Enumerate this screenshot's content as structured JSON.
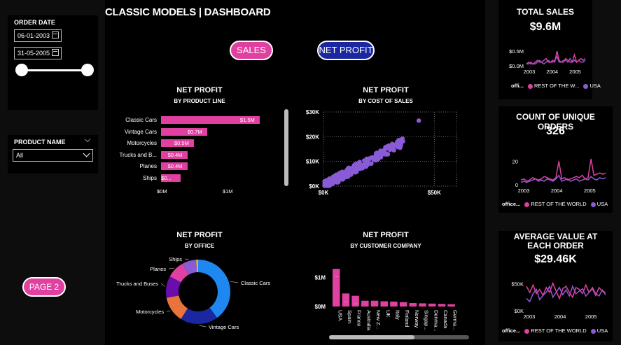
{
  "title": "CLASSIC MODELS | DASHBOARD",
  "filters": {
    "order_date_label": "ORDER DATE",
    "start_date": "06-01-2003",
    "end_date": "31-05-2005",
    "product_name_label": "PRODUCT NAME",
    "product_name_value": "All"
  },
  "toggle": {
    "sales": "SALES",
    "net_profit": "NET PROFIT"
  },
  "page2": "PAGE 2",
  "colors": {
    "pink": "#e040a0",
    "navy": "#1a27a0",
    "purple": "#8a5bd6",
    "blue": "#1e88f0"
  },
  "kpis": {
    "total_sales": {
      "title": "TOTAL SALES",
      "value": "$9.6M",
      "y_ticks": [
        "$0.5M",
        "$0.0M"
      ],
      "x_ticks": [
        "2003",
        "2004",
        "2005"
      ]
    },
    "unique_orders": {
      "title": "COUNT OF UNIQUE ORDERS",
      "value": "326",
      "y_ticks": [
        "20",
        "0"
      ],
      "x_ticks": [
        "2003",
        "2004",
        "2005"
      ]
    },
    "avg_order": {
      "title": "AVERAGE VALUE AT EACH ORDER",
      "value": "$29.46K",
      "y_ticks": [
        "$50K",
        "$0K"
      ],
      "x_ticks": [
        "2003",
        "2004",
        "2005"
      ]
    },
    "legend_short": {
      "prefix": "offi...",
      "rest": "REST OF THE W...",
      "usa": "USA"
    },
    "legend_long": {
      "prefix": "office...",
      "rest": "REST OF THE WORLD",
      "usa": "USA"
    }
  },
  "chart_data": [
    {
      "type": "bar",
      "title": "NET PROFIT",
      "subtitle": "BY PRODUCT LINE",
      "categories": [
        "Classic Cars",
        "Vintage Cars",
        "Motorcycles",
        "Trucks and B...",
        "Planes",
        "Ships"
      ],
      "values": [
        1.5,
        0.7,
        0.5,
        0.4,
        0.4,
        0.3
      ],
      "data_labels": [
        "$1.5M",
        "$0.7M",
        "$0.5M",
        "$0.4M",
        "$0.4M",
        "$0..."
      ],
      "x_ticks": [
        "$0M",
        "$1M"
      ],
      "xlim": [
        0,
        1.65
      ]
    },
    {
      "type": "scatter",
      "title": "NET PROFIT",
      "subtitle": "BY COST OF SALES",
      "y_ticks": [
        "$30K",
        "$20K",
        "$10K",
        "$0K"
      ],
      "x_ticks": [
        "$0K",
        "$50K"
      ],
      "xlim": [
        0,
        60
      ],
      "ylim": [
        0,
        30
      ]
    },
    {
      "type": "pie",
      "title": "NET PROFIT",
      "subtitle": "BY OFFICE",
      "labels": [
        "Classic Cars",
        "Vintage Cars",
        "Motorcycles",
        "Trucks and Buses",
        "Planes",
        "Ships",
        ""
      ],
      "values": [
        40,
        19,
        13,
        11,
        9,
        7,
        1
      ],
      "colors": [
        "#1e88f0",
        "#1a27a0",
        "#e8743b",
        "#6a0dad",
        "#e040a0",
        "#8a5bd6",
        "#f0b429"
      ]
    },
    {
      "type": "bar",
      "title": "NET PROFIT",
      "subtitle": "BY CUSTOMER COMPANY",
      "categories": [
        "USA",
        "Spain",
        "France",
        "Australia",
        "New Z...",
        "UK",
        "Italy",
        "Finland",
        "Norway",
        "Singap...",
        "Denma...",
        "Canada",
        "Germa..."
      ],
      "values": [
        1.3,
        0.45,
        0.37,
        0.2,
        0.2,
        0.18,
        0.17,
        0.15,
        0.12,
        0.11,
        0.1,
        0.09,
        0.08
      ],
      "data_labels": [
        "...",
        "...",
        "...",
        "",
        "",
        "",
        "",
        "",
        "",
        "",
        "",
        "",
        ""
      ],
      "y_ticks": [
        "$1M",
        "$0M"
      ],
      "ylim": [
        0,
        1.4
      ]
    }
  ]
}
